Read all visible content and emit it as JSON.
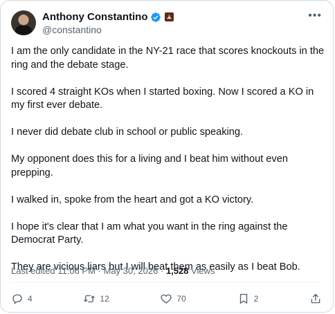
{
  "author": {
    "name": "Anthony Constantino",
    "handle": "@constantino"
  },
  "post": {
    "paragraphs": [
      "I am the only candidate in the NY-21 race that scores knockouts in the ring and the debate stage.",
      "I scored 4 straight KOs when I started boxing. Now I scored a KO in my first ever debate.",
      "I never did debate club in school or public speaking.",
      "My opponent does this for a living and I beat him without even prepping.",
      "I walked in, spoke from the heart and got a KO victory.",
      "I hope it's clear that I am what you want in the ring against the Democrat Party.",
      "They are vicious liars but I will beat them as easily as I beat Bob."
    ]
  },
  "meta": {
    "edited": "Last edited 11:06 PM",
    "sep1": "·",
    "date": "May 30, 2026",
    "sep2": "·",
    "views_count": "1,528",
    "views_label": "Views"
  },
  "actions": {
    "replies": "4",
    "reposts": "12",
    "likes": "70",
    "bookmarks": "2"
  },
  "colors": {
    "verified": "#1d9bf0",
    "affiliate_badge": "#5b2a1c",
    "muted_text": "#536471"
  }
}
